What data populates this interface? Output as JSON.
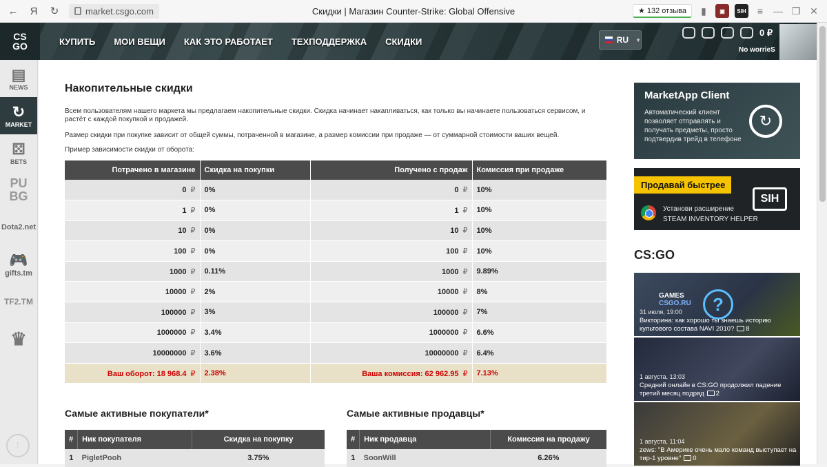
{
  "browser": {
    "url": "market.csgo.com",
    "title": "Скидки | Магазин Counter-Strike: Global Offensive",
    "reviews": "★ 132 отзыва",
    "ext_label": "SIH",
    "yandex": "Я"
  },
  "header": {
    "logo_line1": "CS",
    "logo_line2": "GO",
    "nav": [
      "КУПИТЬ",
      "МОИ ВЕЩИ",
      "КАК ЭТО РАБОТАЕТ",
      "ТЕХПОДДЕРЖКА",
      "СКИДКИ"
    ],
    "lang": "RU",
    "balance": "0 ₽",
    "username": "No worrieS"
  },
  "sidebar": {
    "items": [
      {
        "label": "NEWS",
        "glyph": "▤"
      },
      {
        "label": "MARKET",
        "glyph": "↻"
      },
      {
        "label": "BETS",
        "glyph": "⚄"
      },
      {
        "label": "PU BG",
        "glyph": ""
      },
      {
        "label": "Dota2.net",
        "glyph": ""
      },
      {
        "label": "gifts.tm",
        "glyph": "🎮"
      },
      {
        "label": "TF2.TM",
        "glyph": ""
      },
      {
        "label": "",
        "glyph": "♛"
      }
    ]
  },
  "content": {
    "title": "Накопительные скидки",
    "para1": "Всем пользователям нашего маркета мы предлагаем накопительные скидки. Скидка начинает накапливаться, как только вы начинаете пользоваться сервисом, и растёт с каждой покупкой и продажей.",
    "para2": "Размер скидки при покупке зависит от общей суммы, потраченной в магазине, а размер комиссии при продаже — от суммарной стоимости ваших вещей.",
    "para3": "Пример зависимости скидки от оборота:",
    "table": {
      "headers": [
        "Потрачено в магазине",
        "Скидка на покупки",
        "Получено с продаж",
        "Комиссия при продаже"
      ],
      "currency": "₽",
      "rows": [
        [
          "0",
          "0%",
          "0",
          "10%"
        ],
        [
          "1",
          "0%",
          "1",
          "10%"
        ],
        [
          "10",
          "0%",
          "10",
          "10%"
        ],
        [
          "100",
          "0%",
          "100",
          "10%"
        ],
        [
          "1000",
          "0.11%",
          "1000",
          "9.89%"
        ],
        [
          "10000",
          "2%",
          "10000",
          "8%"
        ],
        [
          "100000",
          "3%",
          "100000",
          "7%"
        ],
        [
          "1000000",
          "3.4%",
          "1000000",
          "6.6%"
        ],
        [
          "10000000",
          "3.6%",
          "10000000",
          "6.4%"
        ]
      ],
      "total": [
        "Ваш оборот: 18 968.4",
        "2.38%",
        "Ваша комиссия: 62 962.95",
        "7.13%"
      ]
    },
    "buyers": {
      "title": "Самые активные покупатели*",
      "headers": [
        "#",
        "Ник покупателя",
        "Скидка на покупку"
      ],
      "rows": [
        [
          "1",
          "PigletPooh",
          "3.75%"
        ]
      ]
    },
    "sellers": {
      "title": "Самые активные продавцы*",
      "headers": [
        "#",
        "Ник продавца",
        "Комиссия на продажу"
      ],
      "rows": [
        [
          "1",
          "SoonWill",
          "6.26%"
        ]
      ]
    }
  },
  "right": {
    "marketapp": {
      "title": "MarketApp Client",
      "desc": "Автоматический клиент позволяет отправлять и получать предметы, просто подтвердив трейд в телефоне"
    },
    "sih": {
      "banner": "Продавай быстрее",
      "line1": "Установи расширение",
      "line2": "STEAM INVENTORY HELPER",
      "logo": "SIH"
    },
    "section": "CS:GO",
    "news": [
      {
        "date": "31 июля, 19:00",
        "title": "Викторина: как хорошо ты знаешь историю культового состава NAVI 2010?",
        "comments": "8",
        "logo_line1": "GAMES",
        "logo_line2": "CSGO.RU"
      },
      {
        "date": "1 августа, 13:03",
        "title": "Средний онлайн в CS:GO продолжил падение третий месяц подряд",
        "comments": "2"
      },
      {
        "date": "1 августа, 11:04",
        "title": "zews: \"В Америке очень мало команд выступает на тир-1 уровне\"",
        "comments": "0"
      }
    ]
  },
  "colors": {
    "header_dark": "#2e3c3f",
    "table_header": "#4b4b4b",
    "total_row": "#e9e0c8",
    "total_text": "#cc0000",
    "sih_yellow": "#f5c300"
  }
}
